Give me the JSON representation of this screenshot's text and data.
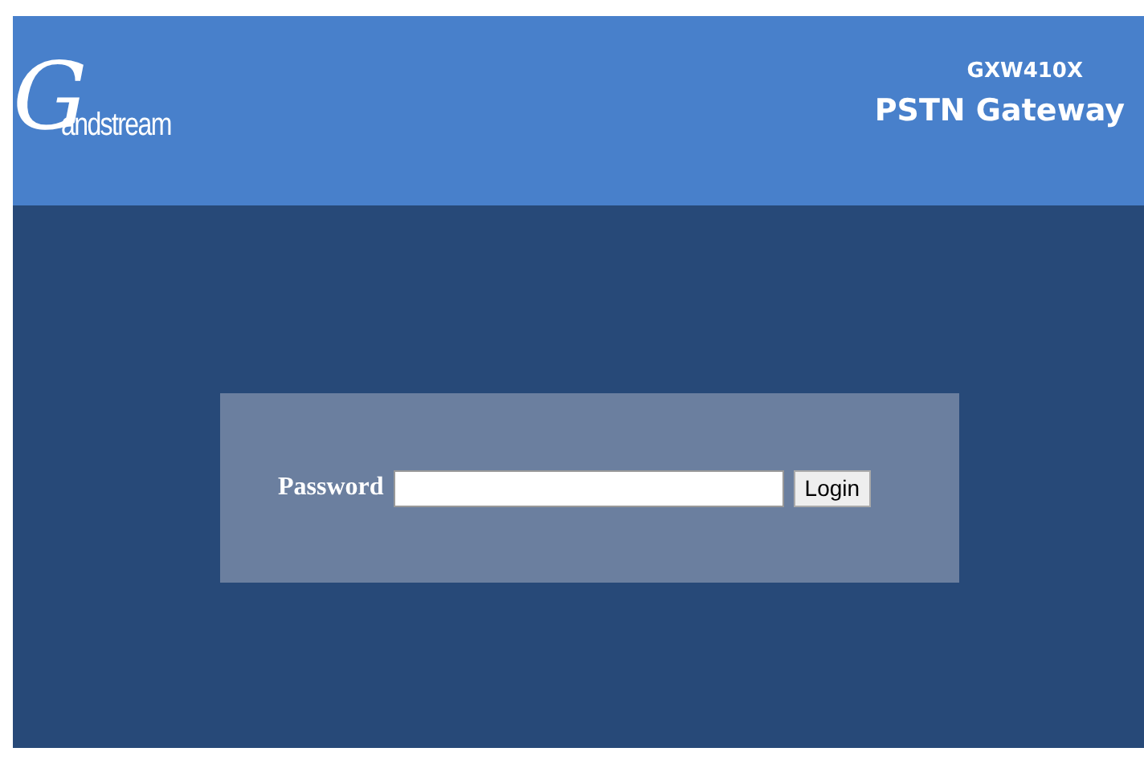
{
  "header": {
    "logo": {
      "initial": "G",
      "rest": "andstream"
    },
    "model": "GXW410X",
    "product": "PSTN Gateway"
  },
  "login": {
    "label": "Password",
    "button": "Login"
  }
}
